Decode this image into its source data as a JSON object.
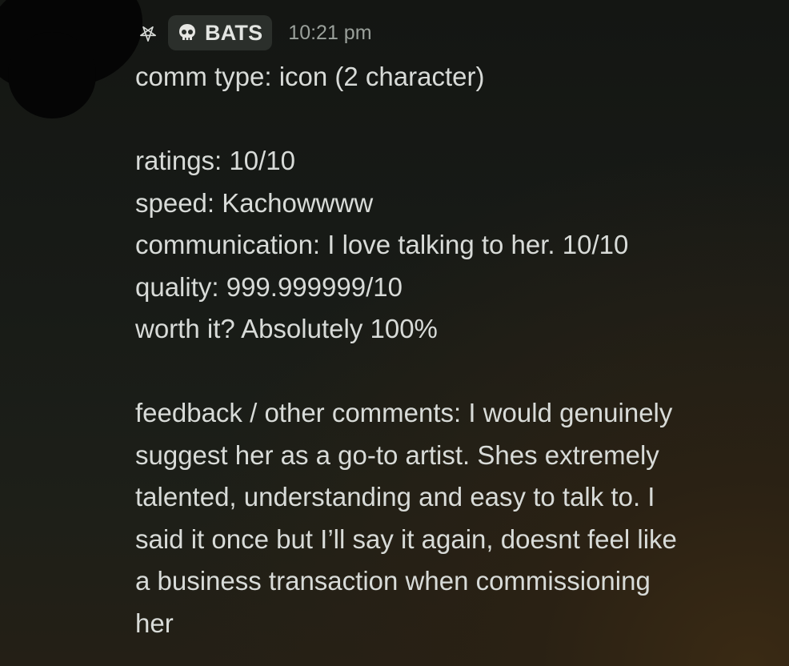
{
  "header": {
    "server_tag": "BATS",
    "timestamp": "10:21 pm"
  },
  "message": {
    "comm_type": "comm type: icon (2 character)",
    "ratings": "ratings: 10/10",
    "speed": "speed: Kachowwww",
    "communication": "communication: I love talking to her. 10/10",
    "quality": "quality: 999.999999/10",
    "worth_it": "worth it? Absolutely 100%",
    "feedback_lines": [
      "feedback / other comments: I would genuinely",
      "suggest her as a go-to artist. Shes extremely",
      "talented, understanding and easy to talk to. I",
      "said it once but I’ll say it again, doesnt feel like",
      "a business transaction when commissioning",
      "her"
    ]
  },
  "icons": {
    "role_icon": "pentagram-icon",
    "tag_icon": "skull-icon"
  },
  "colors": {
    "background": "#181b17",
    "text": "#d8dbd8",
    "tag_background": "#2b2f2b",
    "timestamp": "#9aa09b"
  }
}
